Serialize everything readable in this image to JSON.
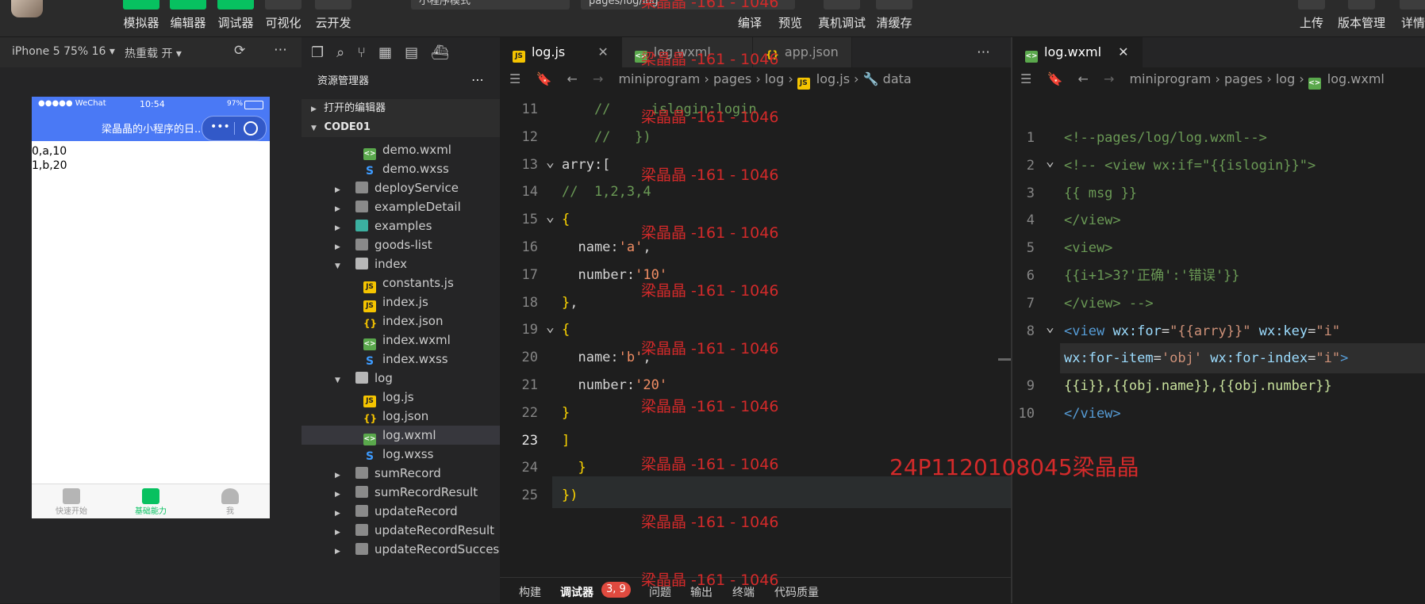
{
  "toolbar": {
    "left_buttons": [
      "模拟器",
      "编辑器",
      "调试器",
      "可视化",
      "云开发"
    ],
    "mode_select": "小程序模式",
    "path_field": "pages/log/log",
    "center_buttons": [
      "编译",
      "预览",
      "真机调试",
      "清缓存"
    ],
    "right_buttons": [
      "上传",
      "版本管理",
      "详情"
    ]
  },
  "simulator": {
    "device": "iPhone 5 75% 16 ▾",
    "hot_reload": "热重载 开 ▾",
    "status_carrier": "●●●●● WeChat",
    "status_time": "10:54",
    "status_battery": "97%",
    "nav_title": "梁晶晶的小程序的日...",
    "content_lines": [
      "0,a,10",
      "1,b,20"
    ],
    "tabs": [
      "快速开始",
      "基础能力",
      "我"
    ]
  },
  "explorer": {
    "title": "资源管理器",
    "open_editors": "打开的编辑器",
    "project": "CODE01",
    "rows": [
      {
        "name": "demo.wxml",
        "type": "wxml",
        "depth": 2
      },
      {
        "name": "demo.wxss",
        "type": "wxss",
        "depth": 2
      },
      {
        "name": "deployService",
        "type": "folder",
        "depth": 1
      },
      {
        "name": "exampleDetail",
        "type": "folder",
        "depth": 1
      },
      {
        "name": "examples",
        "type": "ex",
        "depth": 1
      },
      {
        "name": "goods-list",
        "type": "folder",
        "depth": 1
      },
      {
        "name": "index",
        "type": "folder-open",
        "depth": 1
      },
      {
        "name": "constants.js",
        "type": "js",
        "depth": 2
      },
      {
        "name": "index.js",
        "type": "js",
        "depth": 2
      },
      {
        "name": "index.json",
        "type": "json",
        "depth": 2
      },
      {
        "name": "index.wxml",
        "type": "wxml",
        "depth": 2
      },
      {
        "name": "index.wxss",
        "type": "wxss",
        "depth": 2
      },
      {
        "name": "log",
        "type": "folder-open",
        "depth": 1
      },
      {
        "name": "log.js",
        "type": "js",
        "depth": 2
      },
      {
        "name": "log.json",
        "type": "json",
        "depth": 2
      },
      {
        "name": "log.wxml",
        "type": "wxml",
        "depth": 2,
        "selected": true
      },
      {
        "name": "log.wxss",
        "type": "wxss",
        "depth": 2
      },
      {
        "name": "sumRecord",
        "type": "folder",
        "depth": 1
      },
      {
        "name": "sumRecordResult",
        "type": "folder",
        "depth": 1
      },
      {
        "name": "updateRecord",
        "type": "folder",
        "depth": 1
      },
      {
        "name": "updateRecordResult",
        "type": "folder",
        "depth": 1
      },
      {
        "name": "updateRecordSuccess",
        "type": "folder",
        "depth": 1
      }
    ]
  },
  "editor1": {
    "tabs": [
      "log.js",
      "log.wxml",
      "app.json"
    ],
    "breadcrumb": [
      "miniprogram",
      "pages",
      "log",
      "log.js",
      "data"
    ],
    "lines": [
      {
        "n": "11",
        "text": "    //     islogin:login"
      },
      {
        "n": "12",
        "text": "    //   })"
      },
      {
        "n": "13",
        "text": "arry:["
      },
      {
        "n": "14",
        "text": "//  1,2,3,4"
      },
      {
        "n": "15",
        "text": "{"
      },
      {
        "n": "16",
        "text": "  name:'a',"
      },
      {
        "n": "17",
        "text": "  number:'10'"
      },
      {
        "n": "18",
        "text": "},"
      },
      {
        "n": "19",
        "text": "{"
      },
      {
        "n": "20",
        "text": "  name:'b',"
      },
      {
        "n": "21",
        "text": "  number:'20'"
      },
      {
        "n": "22",
        "text": "}"
      },
      {
        "n": "23",
        "text": "]"
      },
      {
        "n": "24",
        "text": "  }"
      },
      {
        "n": "25",
        "text": "})"
      }
    ]
  },
  "editor2": {
    "tab": "log.wxml",
    "breadcrumb": [
      "miniprogram",
      "pages",
      "log",
      "log.wxml"
    ],
    "lines": [
      {
        "n": "1",
        "text": "<!--pages/log/log.wxml-->"
      },
      {
        "n": "2",
        "text": "<!-- <view wx:if=\"{{islogin}}\">"
      },
      {
        "n": "3",
        "text": "{{ msg }}"
      },
      {
        "n": "4",
        "text": "</view>"
      },
      {
        "n": "5",
        "text": "<view>"
      },
      {
        "n": "6",
        "text": "{{i+1>3?'正确':'错误'}}"
      },
      {
        "n": "7",
        "text": "</view> -->"
      },
      {
        "n": "8",
        "text": "<view wx:for=\"{{arry}}\" wx:key=\"i\""
      },
      {
        "n": "",
        "text": "wx:for-item='obj' wx:for-index=\"i\">"
      },
      {
        "n": "9",
        "text": "{{i}},{{obj.name}},{{obj.number}}"
      },
      {
        "n": "10",
        "text": "</view>"
      }
    ]
  },
  "bottom_panel": {
    "tabs": [
      "构建",
      "调试器",
      "问题",
      "输出",
      "终端",
      "代码质量"
    ],
    "badge": "3, 9"
  },
  "watermark": {
    "repeat": "梁晶晶 -161 - 1046",
    "student": "24P1120108045梁晶晶"
  }
}
